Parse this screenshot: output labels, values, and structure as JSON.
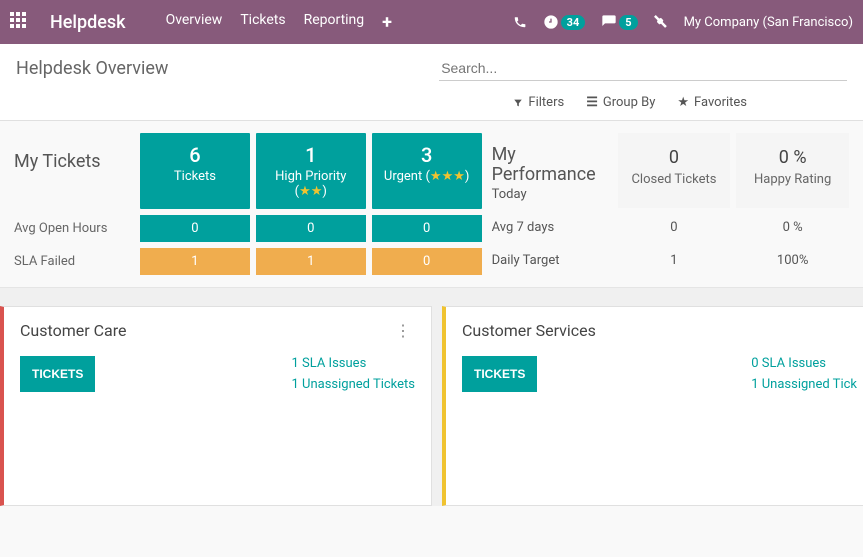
{
  "nav": {
    "brand": "Helpdesk",
    "links": [
      "Overview",
      "Tickets",
      "Reporting"
    ],
    "badge_activities": "34",
    "badge_msgs": "5",
    "company": "My Company (San Francisco)"
  },
  "cp": {
    "title": "Helpdesk Overview",
    "search_placeholder": "Search...",
    "filters": "Filters",
    "groupby": "Group By",
    "favorites": "Favorites"
  },
  "mytickets": {
    "title": "My Tickets",
    "tiles": [
      {
        "num": "6",
        "lbl": "Tickets",
        "stars": 0
      },
      {
        "num": "1",
        "lbl": "High Priority",
        "stars": 2
      },
      {
        "num": "3",
        "lbl": "Urgent",
        "stars": 3
      }
    ],
    "rows": [
      {
        "label": "Avg Open Hours",
        "cells": [
          "0",
          "0",
          "0"
        ],
        "color": "teal"
      },
      {
        "label": "SLA Failed",
        "cells": [
          "1",
          "1",
          "0"
        ],
        "color": "orange"
      }
    ]
  },
  "perf": {
    "title": "My Performance",
    "today_label": "Today",
    "kpis": [
      {
        "num": "0",
        "lbl": "Closed Tickets"
      },
      {
        "num": "0 %",
        "lbl": "Happy Rating"
      }
    ],
    "rows": [
      {
        "label": "Avg 7 days",
        "cells": [
          "0",
          "0 %"
        ]
      },
      {
        "label": "Daily Target",
        "cells": [
          "1",
          "100%"
        ]
      }
    ]
  },
  "teams": [
    {
      "name": "Customer Care",
      "color": "red",
      "button": "TICKETS",
      "links": [
        "1 SLA Issues",
        "1 Unassigned Tickets"
      ]
    },
    {
      "name": "Customer Services",
      "color": "yellow",
      "button": "TICKETS",
      "links": [
        "0 SLA Issues",
        "1 Unassigned Tick"
      ]
    }
  ]
}
